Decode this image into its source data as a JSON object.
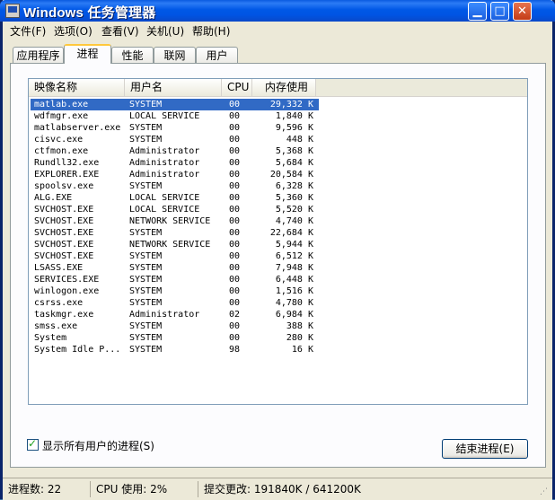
{
  "window": {
    "title": "Windows 任务管理器",
    "min_glyph": "▁",
    "max_glyph": "□",
    "close_glyph": "✕"
  },
  "menu": [
    "文件(F)",
    "选项(O)",
    "查看(V)",
    "关机(U)",
    "帮助(H)"
  ],
  "tabs": [
    "应用程序",
    "进程",
    "性能",
    "联网",
    "用户"
  ],
  "active_tab": "进程",
  "table": {
    "columns": [
      "映像名称",
      "用户名",
      "CPU",
      "内存使用"
    ],
    "rows": [
      {
        "name": "matlab.exe",
        "user": "SYSTEM",
        "cpu": "00",
        "mem": "29,332 K",
        "selected": true
      },
      {
        "name": "wdfmgr.exe",
        "user": "LOCAL SERVICE",
        "cpu": "00",
        "mem": "1,840 K"
      },
      {
        "name": "matlabserver.exe",
        "user": "SYSTEM",
        "cpu": "00",
        "mem": "9,596 K"
      },
      {
        "name": "cisvc.exe",
        "user": "SYSTEM",
        "cpu": "00",
        "mem": "448 K"
      },
      {
        "name": "ctfmon.exe",
        "user": "Administrator",
        "cpu": "00",
        "mem": "5,368 K"
      },
      {
        "name": "Rundll32.exe",
        "user": "Administrator",
        "cpu": "00",
        "mem": "5,684 K"
      },
      {
        "name": "EXPLORER.EXE",
        "user": "Administrator",
        "cpu": "00",
        "mem": "20,584 K"
      },
      {
        "name": "spoolsv.exe",
        "user": "SYSTEM",
        "cpu": "00",
        "mem": "6,328 K"
      },
      {
        "name": "ALG.EXE",
        "user": "LOCAL SERVICE",
        "cpu": "00",
        "mem": "5,360 K"
      },
      {
        "name": "SVCHOST.EXE",
        "user": "LOCAL SERVICE",
        "cpu": "00",
        "mem": "5,520 K"
      },
      {
        "name": "SVCHOST.EXE",
        "user": "NETWORK SERVICE",
        "cpu": "00",
        "mem": "4,740 K"
      },
      {
        "name": "SVCHOST.EXE",
        "user": "SYSTEM",
        "cpu": "00",
        "mem": "22,684 K"
      },
      {
        "name": "SVCHOST.EXE",
        "user": "NETWORK SERVICE",
        "cpu": "00",
        "mem": "5,944 K"
      },
      {
        "name": "SVCHOST.EXE",
        "user": "SYSTEM",
        "cpu": "00",
        "mem": "6,512 K"
      },
      {
        "name": "LSASS.EXE",
        "user": "SYSTEM",
        "cpu": "00",
        "mem": "7,948 K"
      },
      {
        "name": "SERVICES.EXE",
        "user": "SYSTEM",
        "cpu": "00",
        "mem": "6,448 K"
      },
      {
        "name": "winlogon.exe",
        "user": "SYSTEM",
        "cpu": "00",
        "mem": "1,516 K"
      },
      {
        "name": "csrss.exe",
        "user": "SYSTEM",
        "cpu": "00",
        "mem": "4,780 K"
      },
      {
        "name": "taskmgr.exe",
        "user": "Administrator",
        "cpu": "02",
        "mem": "6,984 K"
      },
      {
        "name": "smss.exe",
        "user": "SYSTEM",
        "cpu": "00",
        "mem": "388 K"
      },
      {
        "name": "System",
        "user": "SYSTEM",
        "cpu": "00",
        "mem": "280 K"
      },
      {
        "name": "System Idle P...",
        "user": "SYSTEM",
        "cpu": "98",
        "mem": "16 K"
      }
    ]
  },
  "show_all_users": {
    "label": "显示所有用户的进程(S)",
    "checked": true
  },
  "end_process_label": "结束进程(E)",
  "status": {
    "processes": "进程数: 22",
    "cpu": "CPU 使用: 2%",
    "commit": "提交更改: 191840K / 641200K"
  },
  "colors": {
    "selection": "#316ac5",
    "titlebar": "#0054e3",
    "face": "#ece9d8"
  }
}
